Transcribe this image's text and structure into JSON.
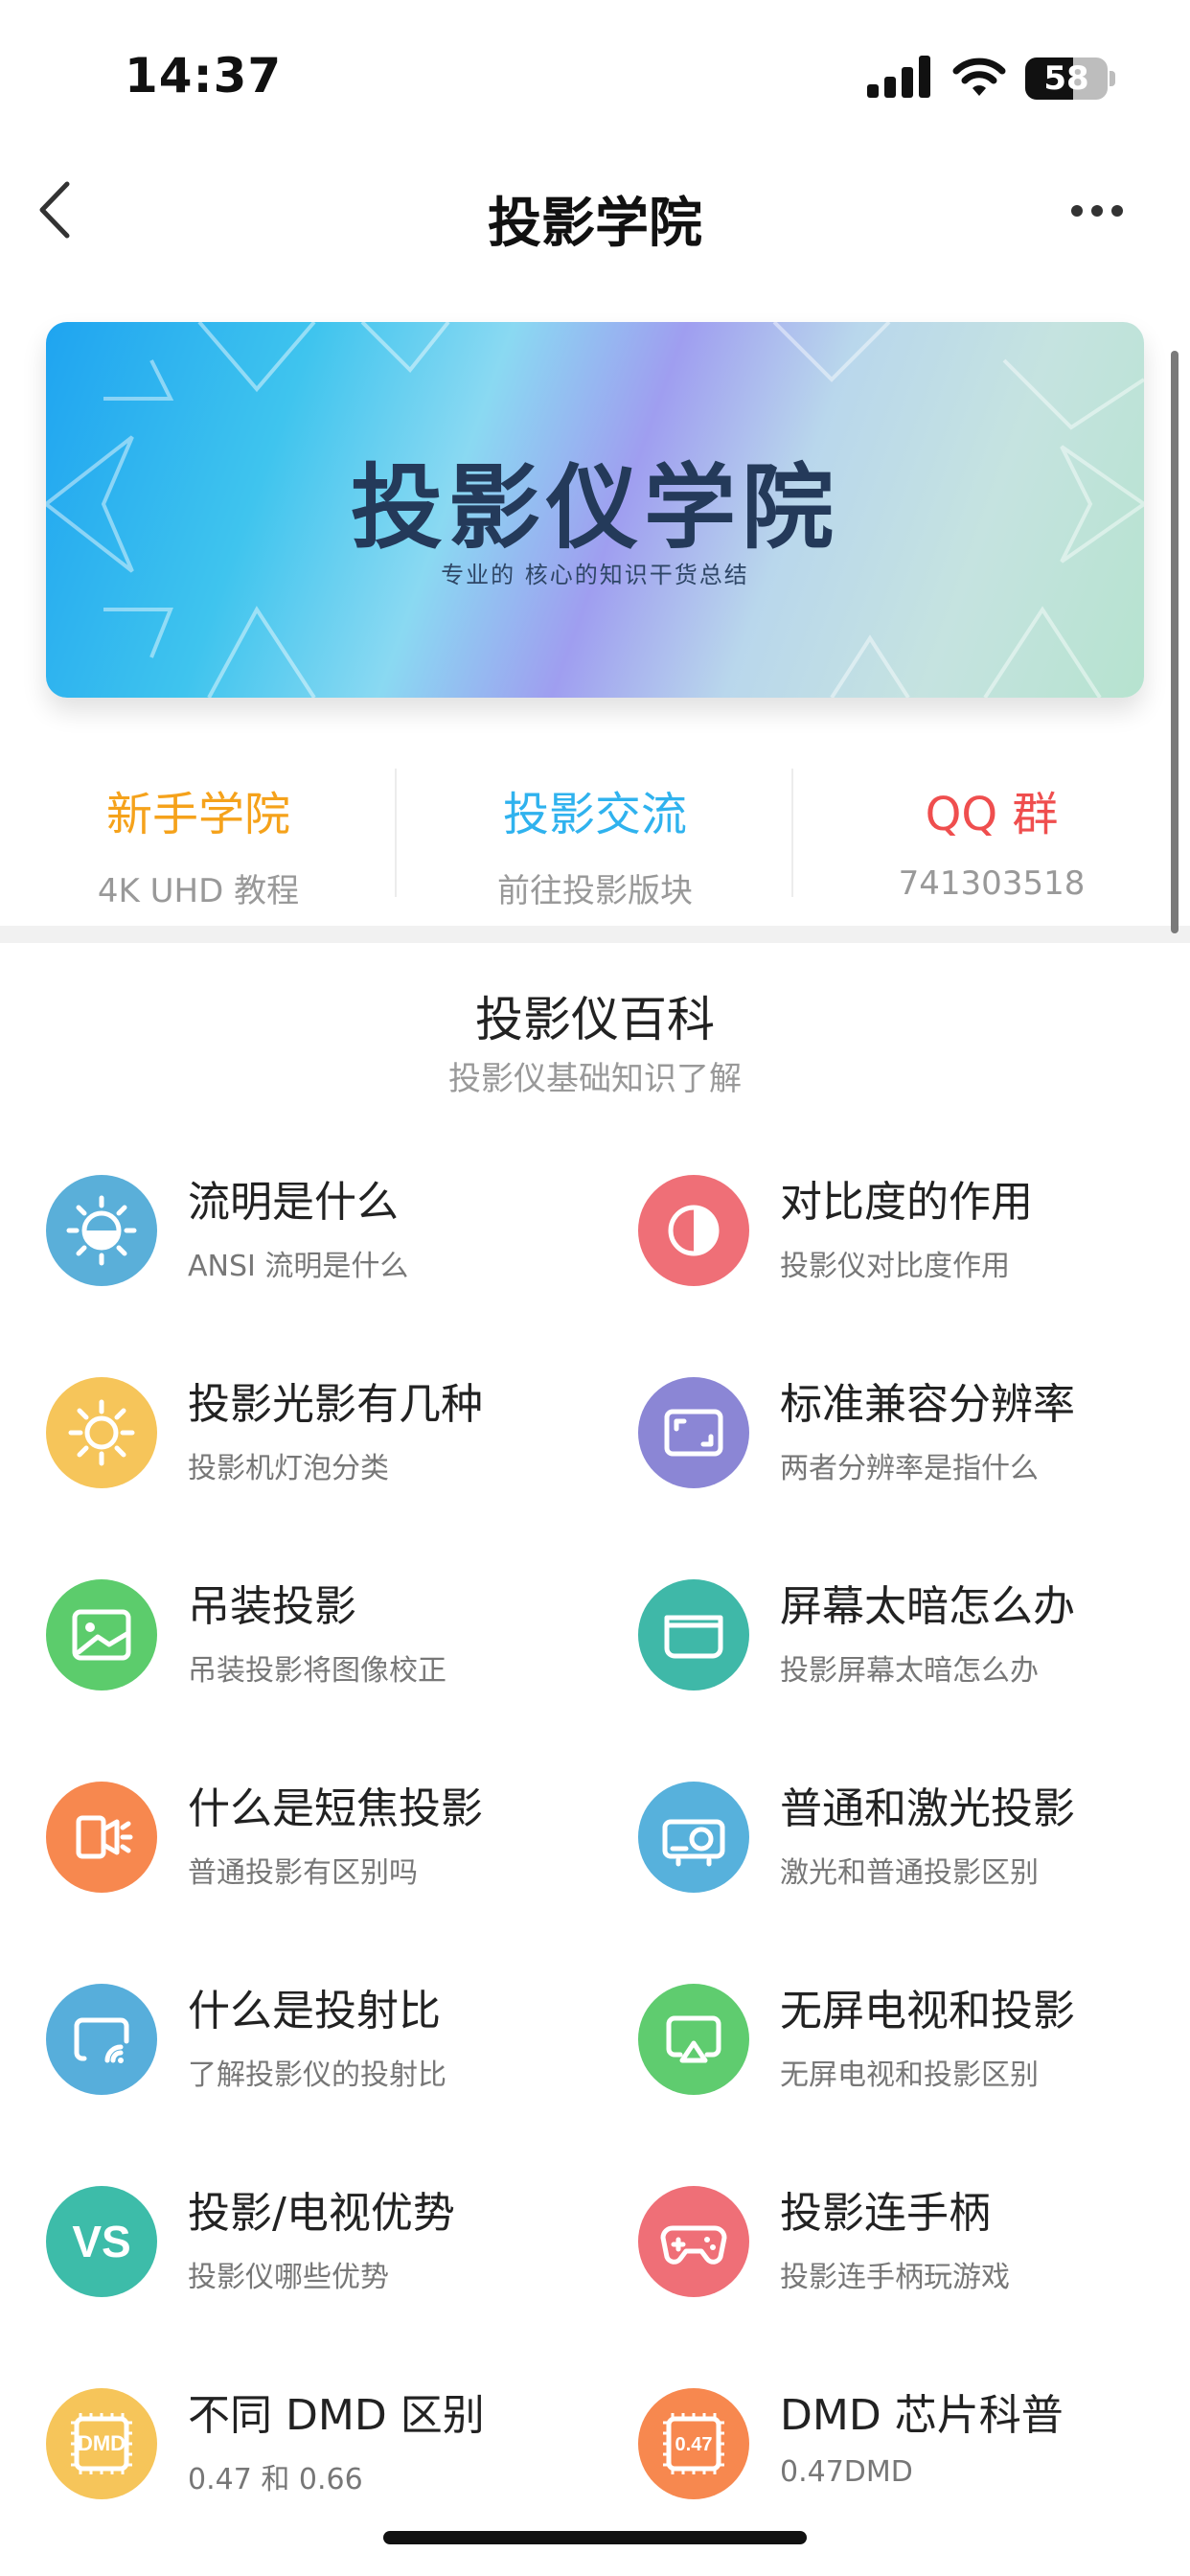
{
  "status_bar": {
    "time": "14:37",
    "battery": "58",
    "battery_level": 0.58
  },
  "nav": {
    "title": "投影学院",
    "back_icon": "chevron-left-icon",
    "more_icon": "more-dots-icon"
  },
  "banner": {
    "title": "投影仪学院",
    "subtitle": "专业的 核心的知识干货总结"
  },
  "quick_links": [
    {
      "title": "新手学院",
      "subtitle": "4K UHD 教程",
      "color": "#f5a21b"
    },
    {
      "title": "投影交流",
      "subtitle": "前往投影版块",
      "color": "#2fb2ee"
    },
    {
      "title": "QQ 群",
      "subtitle": "741303518",
      "color": "#ef4e4e"
    }
  ],
  "section": {
    "title": "投影仪百科",
    "subtitle": "投影仪基础知识了解"
  },
  "items": [
    {
      "title": "流明是什么",
      "subtitle": "ANSI 流明是什么",
      "icon": "brightness-icon",
      "color": "#5aafd9"
    },
    {
      "title": "对比度的作用",
      "subtitle": "投影仪对比度作用",
      "icon": "contrast-icon",
      "color": "#ef6f77"
    },
    {
      "title": "投影光影有几种",
      "subtitle": "投影机灯泡分类",
      "icon": "sun-icon",
      "color": "#f6c55a"
    },
    {
      "title": "标准兼容分辨率",
      "subtitle": "两者分辨率是指什么",
      "icon": "resolution-icon",
      "color": "#8b86d5"
    },
    {
      "title": "吊装投影",
      "subtitle": "吊装投影将图像校正",
      "icon": "image-icon",
      "color": "#5ccc6c"
    },
    {
      "title": "屏幕太暗怎么办",
      "subtitle": "投影屏幕太暗怎么办",
      "icon": "screen-icon",
      "color": "#3fb8a8"
    },
    {
      "title": "什么是短焦投影",
      "subtitle": "普通投影有区别吗",
      "icon": "short-throw-icon",
      "color": "#f7884f"
    },
    {
      "title": "普通和激光投影",
      "subtitle": "激光和普通投影区别",
      "icon": "projector-icon",
      "color": "#57b1dc"
    },
    {
      "title": "什么是投射比",
      "subtitle": "了解投影仪的投射比",
      "icon": "cast-screen-icon",
      "color": "#57aedb"
    },
    {
      "title": "无屏电视和投影",
      "subtitle": "无屏电视和投影区别",
      "icon": "airplay-icon",
      "color": "#5fcc6f"
    },
    {
      "title": "投影/电视优势",
      "subtitle": "投影仪哪些优势",
      "icon": "vs-icon",
      "color": "#3dbca9",
      "icon_text": "VS"
    },
    {
      "title": "投影连手柄",
      "subtitle": "投影连手柄玩游戏",
      "icon": "gamepad-icon",
      "color": "#ef6f77"
    },
    {
      "title": "不同 DMD 区别",
      "subtitle": "0.47 和 0.66",
      "icon": "dmd-chip-icon",
      "color": "#f6c55a",
      "icon_text": "DMD"
    },
    {
      "title": "DMD 芯片科普",
      "subtitle": "0.47DMD",
      "icon": "chip-047-icon",
      "color": "#f7884f",
      "icon_text": "0.47"
    }
  ]
}
